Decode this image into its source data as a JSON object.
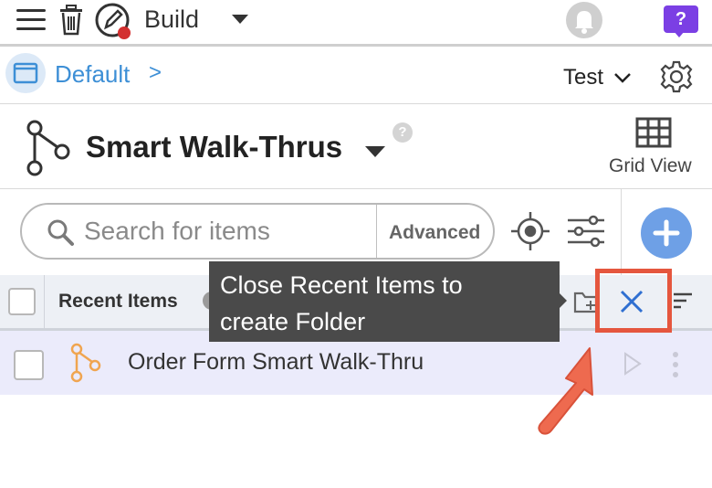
{
  "topbar": {
    "build_label": "Build",
    "help_label": "?"
  },
  "breadcrumb": {
    "label": "Default",
    "separator": ">",
    "environment": "Test"
  },
  "header": {
    "title": "Smart Walk-Thrus",
    "help_mark": "?",
    "grid_view_label": "Grid View"
  },
  "search": {
    "placeholder": "Search for items",
    "advanced_label": "Advanced"
  },
  "list": {
    "header_label": "Recent Items",
    "rows": [
      {
        "label": "Order Form Smart Walk-Thru"
      }
    ]
  },
  "tooltip": {
    "line1": "Close Recent Items to",
    "line2": "create Folder"
  },
  "colors": {
    "accent_blue": "#3d8fd6",
    "help_purple": "#7b3fe4",
    "highlight_red": "#e5563e",
    "walkthru_orange": "#f0a550",
    "close_blue": "#2f6fd1"
  }
}
